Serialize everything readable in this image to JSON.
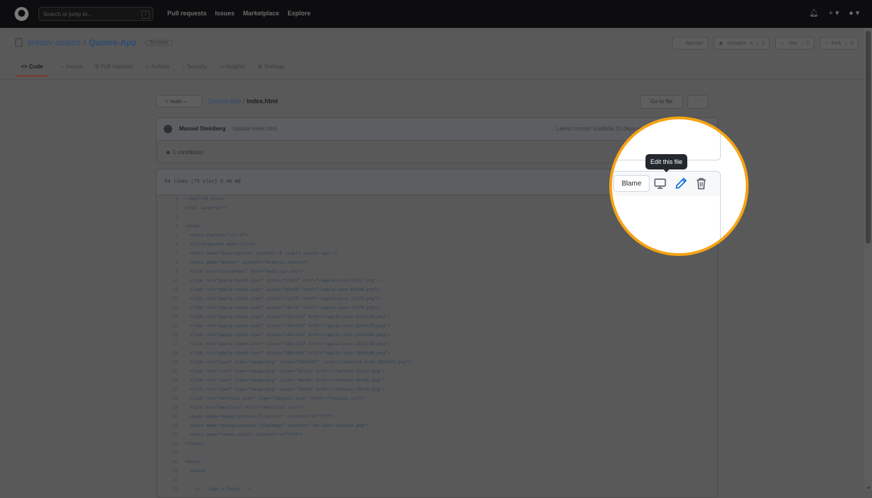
{
  "topbar": {
    "search_placeholder": "Search or jump to...",
    "search_shortcut": "/",
    "nav": [
      "Pull requests",
      "Issues",
      "Marketplace",
      "Explore"
    ],
    "right_icons": [
      "bell-icon",
      "plus-icon",
      "avatar-icon"
    ]
  },
  "repo": {
    "owner": "kreativ-anders",
    "separator": "/",
    "name": "Quotes-App",
    "badge": "Template",
    "actions": {
      "sponsor": "Sponsor",
      "unwatch": "Unwatch",
      "unwatch_count": "1",
      "star": "Star",
      "star_count": "0",
      "fork": "Fork",
      "fork_count": "0"
    },
    "tabs": [
      "Code",
      "Issues",
      "Pull requests",
      "Actions",
      "Security",
      "Insights",
      "Settings"
    ],
    "active_tab": "Code"
  },
  "file": {
    "branch": "main",
    "crumb_repo": "Quotes-App",
    "crumb_sep": "/",
    "crumb_file": "index.html",
    "goto_file": "Go to file",
    "more": "···"
  },
  "commit": {
    "author": "Manuel Steinberg",
    "message": "Update index.html",
    "latest": "Latest commit 3ca6b0a 10 days ago",
    "contributors": "1 contributor"
  },
  "code": {
    "info": "84 lines (75 sloc)   3.49 KB",
    "lines": [
      {
        "n": "1",
        "c": "<!DOCTYPE html>"
      },
      {
        "n": "2",
        "c": "<html lang=\"en\">"
      },
      {
        "n": "3",
        "c": ""
      },
      {
        "n": "4",
        "c": "<head>"
      },
      {
        "n": "5",
        "c": "  <meta charset=\"utf-8\">"
      },
      {
        "n": "6",
        "c": "  <title>Quotes App</title>"
      },
      {
        "n": "7",
        "c": "  <meta name=\"description\" content=\"A simple quotes app.\">"
      },
      {
        "n": "8",
        "c": "  <meta name=\"author\" content=\"kreativ-anders\">"
      },
      {
        "n": "9",
        "c": "  <link rel=\"stylesheet\" href=\"main.min.css\">"
      },
      {
        "n": "10",
        "c": "  <link rel=\"apple-touch-icon\" sizes=\"57x57\" href=\"/apple-icon-57x57.png\">"
      },
      {
        "n": "11",
        "c": "  <link rel=\"apple-touch-icon\" sizes=\"60x60\" href=\"/apple-icon-60x60.png\">"
      },
      {
        "n": "12",
        "c": "  <link rel=\"apple-touch-icon\" sizes=\"72x72\" href=\"/apple-icon-72x72.png\">"
      },
      {
        "n": "13",
        "c": "  <link rel=\"apple-touch-icon\" sizes=\"76x76\" href=\"/apple-icon-76x76.png\">"
      },
      {
        "n": "14",
        "c": "  <link rel=\"apple-touch-icon\" sizes=\"114x114\" href=\"/apple-icon-114x114.png\">"
      },
      {
        "n": "15",
        "c": "  <link rel=\"apple-touch-icon\" sizes=\"120x120\" href=\"/apple-icon-120x120.png\">"
      },
      {
        "n": "16",
        "c": "  <link rel=\"apple-touch-icon\" sizes=\"144x144\" href=\"/apple-icon-144x144.png\">"
      },
      {
        "n": "17",
        "c": "  <link rel=\"apple-touch-icon\" sizes=\"152x152\" href=\"/apple-icon-152x152.png\">"
      },
      {
        "n": "18",
        "c": "  <link rel=\"apple-touch-icon\" sizes=\"180x180\" href=\"/apple-icon-180x180.png\">"
      },
      {
        "n": "19",
        "c": "  <link rel=\"icon\" type=\"image/png\" sizes=\"192x192\"  href=\"/android-icon-192x192.png\">"
      },
      {
        "n": "20",
        "c": "  <link rel=\"icon\" type=\"image/png\" sizes=\"32x32\" href=\"/favicon-32x32.png\">"
      },
      {
        "n": "21",
        "c": "  <link rel=\"icon\" type=\"image/png\" sizes=\"96x96\" href=\"/favicon-96x96.png\">"
      },
      {
        "n": "22",
        "c": "  <link rel=\"icon\" type=\"image/png\" sizes=\"16x16\" href=\"/favicon-16x16.png\">"
      },
      {
        "n": "23",
        "c": "  <link rel=\"shortcut icon\" type=\"image/x-icon\" href=\"/favicon.ico\">"
      },
      {
        "n": "24",
        "c": "  <link rel=\"manifest\" href=\"/manifest.json\">"
      },
      {
        "n": "25",
        "c": "  <meta name=\"msapplication-TileColor\" content=\"#ffffff\">"
      },
      {
        "n": "26",
        "c": "  <meta name=\"msapplication-TileImage\" content=\"/ms-icon-144x144.png\">"
      },
      {
        "n": "27",
        "c": "  <meta name=\"theme-color\" content=\"#ffffff\">"
      },
      {
        "n": "28",
        "c": "</head>"
      },
      {
        "n": "29",
        "c": ""
      },
      {
        "n": "30",
        "c": "<body>"
      },
      {
        "n": "31",
        "c": "  <main>"
      },
      {
        "n": "32",
        "c": ""
      },
      {
        "n": "33",
        "c": "    <!-- Cups & Paste -->"
      }
    ]
  },
  "magnifier": {
    "tooltip": "Edit this file",
    "blame": "Blame",
    "icons": [
      "desktop-icon",
      "pencil-icon",
      "trash-icon"
    ],
    "accent_color": "#f5a314",
    "pencil_color": "#0969da"
  }
}
